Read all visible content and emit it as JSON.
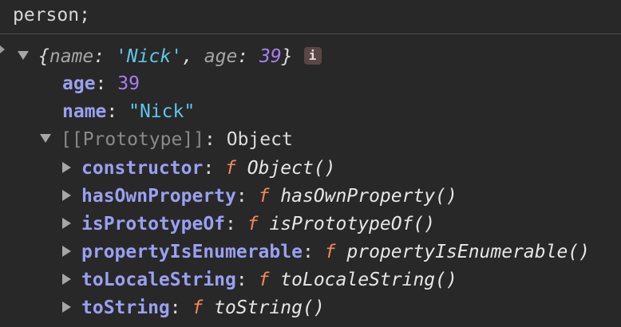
{
  "input": {
    "text": "person;"
  },
  "object": {
    "preview_open": "{",
    "preview_close": "}",
    "preview_name_key": "name",
    "preview_name_value": "'Nick'",
    "preview_age_key": "age",
    "preview_age_value": "39",
    "info_badge": "i"
  },
  "properties": [
    {
      "key": "age",
      "value": "39"
    },
    {
      "key": "name",
      "value": "\"Nick\""
    }
  ],
  "prototype": {
    "key": "[[Prototype]]",
    "value": "Object"
  },
  "prototype_members": [
    {
      "key": "constructor",
      "fn": "f",
      "value": "Object()"
    },
    {
      "key": "hasOwnProperty",
      "fn": "f",
      "value": "hasOwnProperty()"
    },
    {
      "key": "isPrototypeOf",
      "fn": "f",
      "value": "isPrototypeOf()"
    },
    {
      "key": "propertyIsEnumerable",
      "fn": "f",
      "value": "propertyIsEnumerable()"
    },
    {
      "key": "toLocaleString",
      "fn": "f",
      "value": "toLocaleString()"
    },
    {
      "key": "toString",
      "fn": "f",
      "value": "toString()"
    }
  ],
  "colors": {
    "background": "#282828",
    "key": "#9aa0f0",
    "string": "#5fc6e8",
    "number": "#a77ef2",
    "function_keyword": "#f08a5a"
  }
}
